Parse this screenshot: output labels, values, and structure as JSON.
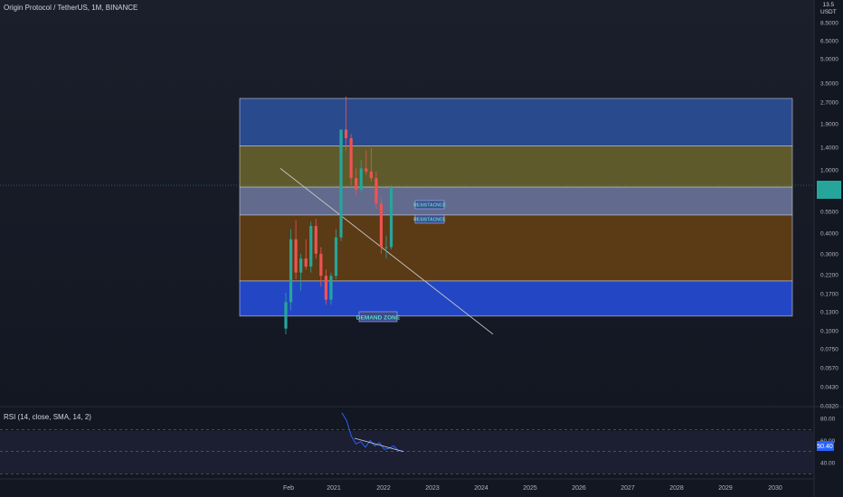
{
  "header": {
    "title": "Origin Protocol / TetherUS, 1M, BINANCE",
    "unit_line1": "13.5",
    "unit_line2": "USDT"
  },
  "rsi_panel": {
    "title": "RSI (14, close, SMA, 14, 2)",
    "current_value": "50.40",
    "axis_ticks": [
      "80.00",
      "60.00",
      "40.00"
    ]
  },
  "price_axis": {
    "tick_labels": [
      "8.5000",
      "6.5000",
      "5.0000",
      "3.5000",
      "2.7000",
      "1.9000",
      "1.4000",
      "1.0000",
      "0.5500",
      "0.4000",
      "0.3000",
      "0.2200",
      "0.1700",
      "0.1300",
      "0.1000",
      "0.0750",
      "0.0570",
      "0.0430",
      "0.0320"
    ]
  },
  "time_axis": {
    "labels": [
      "Feb",
      "2021",
      "2022",
      "2023",
      "2024",
      "2025",
      "2026",
      "2027",
      "2028",
      "2029",
      "2030"
    ]
  },
  "zones": [
    {
      "label": "",
      "color": "#2a4a8e"
    },
    {
      "label": "",
      "color": "#5e5a2b"
    },
    {
      "label": "",
      "color": "#626a8d"
    },
    {
      "label": "",
      "color": "#5b3a16"
    },
    {
      "label": "DEMAND ZONE",
      "color": "#2347c4"
    }
  ],
  "zone_labels": [
    "RESISTACNCE",
    "RESISTACNCE"
  ],
  "colors": {
    "up": "#26a69a",
    "down": "#ef5350",
    "last_price_marker": "#26a69a",
    "rsi_line": "#2962ff",
    "background": "#131722"
  },
  "chart_data": {
    "type": "candlestick",
    "title": "Origin Protocol / TetherUS, 1M, BINANCE",
    "y_scale": "log",
    "ylim": [
      0.032,
      13.5
    ],
    "x_labels": [
      "Feb",
      "2021",
      "2022",
      "2023",
      "2024",
      "2025",
      "2026",
      "2027",
      "2028",
      "2029",
      "2030"
    ],
    "candles": [
      {
        "open": 0.082,
        "high": 0.145,
        "low": 0.075,
        "close": 0.125
      },
      {
        "open": 0.125,
        "high": 0.4,
        "low": 0.11,
        "close": 0.34
      },
      {
        "open": 0.34,
        "high": 0.46,
        "low": 0.18,
        "close": 0.2
      },
      {
        "open": 0.2,
        "high": 0.27,
        "low": 0.15,
        "close": 0.25
      },
      {
        "open": 0.25,
        "high": 0.34,
        "low": 0.21,
        "close": 0.22
      },
      {
        "open": 0.22,
        "high": 0.45,
        "low": 0.2,
        "close": 0.42
      },
      {
        "open": 0.42,
        "high": 0.47,
        "low": 0.25,
        "close": 0.27
      },
      {
        "open": 0.27,
        "high": 0.3,
        "low": 0.16,
        "close": 0.19
      },
      {
        "open": 0.19,
        "high": 0.21,
        "low": 0.12,
        "close": 0.13
      },
      {
        "open": 0.13,
        "high": 0.2,
        "low": 0.12,
        "close": 0.19
      },
      {
        "open": 0.19,
        "high": 0.4,
        "low": 0.18,
        "close": 0.35
      },
      {
        "open": 0.35,
        "high": 1.95,
        "low": 0.33,
        "close": 1.95
      },
      {
        "open": 1.95,
        "high": 3.3,
        "low": 1.4,
        "close": 1.7
      },
      {
        "open": 1.7,
        "high": 1.82,
        "low": 0.8,
        "close": 0.9
      },
      {
        "open": 0.9,
        "high": 1.05,
        "low": 0.68,
        "close": 0.75
      },
      {
        "open": 0.75,
        "high": 1.2,
        "low": 0.72,
        "close": 1.05
      },
      {
        "open": 1.05,
        "high": 1.4,
        "low": 0.95,
        "close": 1.0
      },
      {
        "open": 1.0,
        "high": 1.45,
        "low": 0.85,
        "close": 0.9
      },
      {
        "open": 0.9,
        "high": 1.0,
        "low": 0.55,
        "close": 0.6
      },
      {
        "open": 0.6,
        "high": 0.66,
        "low": 0.27,
        "close": 0.3
      },
      {
        "open": 0.3,
        "high": 0.36,
        "low": 0.25,
        "close": 0.3
      },
      {
        "open": 0.3,
        "high": 0.8,
        "low": 0.29,
        "close": 0.78
      }
    ],
    "zones": [
      {
        "name": "",
        "low": 1.5,
        "high": 3.2
      },
      {
        "name": "",
        "low": 0.78,
        "high": 1.5
      },
      {
        "name": "",
        "low": 0.5,
        "high": 0.78
      },
      {
        "name": "",
        "low": 0.175,
        "high": 0.5
      },
      {
        "name": "DEMAND ZONE",
        "low": 0.1,
        "high": 0.175
      }
    ],
    "trendline": {
      "from": 1.05,
      "to": 0.075
    },
    "rsi": {
      "type": "line",
      "range": [
        20,
        90
      ],
      "levels": [
        70,
        50,
        30
      ],
      "values": [
        85,
        78,
        64,
        57,
        59,
        54,
        60,
        55,
        58,
        52,
        53,
        55,
        51,
        50.4
      ],
      "current": 50.4
    }
  }
}
